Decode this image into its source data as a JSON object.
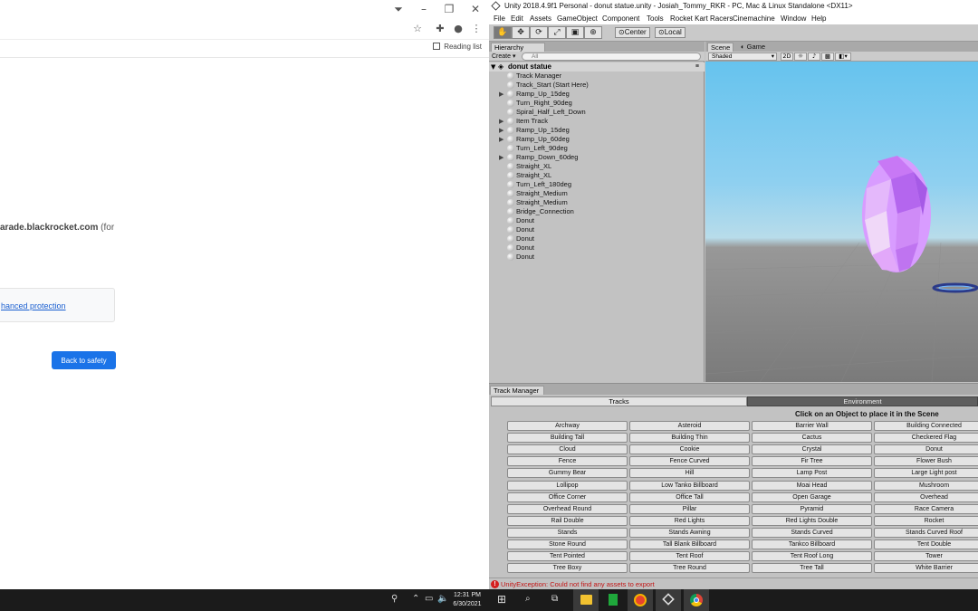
{
  "browser": {
    "reading_list": "Reading list",
    "warning_domain": "arade.blackrocket.com",
    "warning_suffix": " (for",
    "enhanced_link": "hanced protection",
    "back_button": "Back to safety"
  },
  "unity": {
    "title": "Unity 2018.4.9f1 Personal - donut statue.unity - Josiah_Tommy_RKR - PC, Mac & Linux Standalone <DX11>",
    "menu": [
      "File",
      "Edit",
      "Assets",
      "GameObject",
      "Component",
      "Tools",
      "Rocket Kart Racers",
      "Cinemachine",
      "Window",
      "Help"
    ],
    "toolbar": {
      "center": "Center",
      "local": "Local"
    },
    "hierarchy": {
      "tab": "Hierarchy",
      "create": "Create",
      "search_placeholder": "All",
      "scene_name": "donut statue",
      "items": [
        {
          "label": "Track Manager",
          "expand": false
        },
        {
          "label": "Track_Start (Start Here)",
          "expand": false
        },
        {
          "label": "Ramp_Up_15deg",
          "expand": true
        },
        {
          "label": "Turn_Right_90deg",
          "expand": false
        },
        {
          "label": "Spiral_Half_Left_Down",
          "expand": false
        },
        {
          "label": "Item Track",
          "expand": true
        },
        {
          "label": "Ramp_Up_15deg",
          "expand": true
        },
        {
          "label": "Ramp_Up_60deg",
          "expand": true
        },
        {
          "label": "Turn_Left_90deg",
          "expand": false
        },
        {
          "label": "Ramp_Down_60deg",
          "expand": true
        },
        {
          "label": "Straight_XL",
          "expand": false
        },
        {
          "label": "Straight_XL",
          "expand": false
        },
        {
          "label": "Turn_Left_180deg",
          "expand": false
        },
        {
          "label": "Straight_Medium",
          "expand": false
        },
        {
          "label": "Straight_Medium",
          "expand": false
        },
        {
          "label": "Bridge_Connection",
          "expand": false
        },
        {
          "label": "Donut",
          "expand": false
        },
        {
          "label": "Donut",
          "expand": false
        },
        {
          "label": "Donut",
          "expand": false
        },
        {
          "label": "Donut",
          "expand": false
        },
        {
          "label": "Donut",
          "expand": false
        }
      ]
    },
    "scene": {
      "tab_scene": "Scene",
      "tab_game": "Game",
      "shading": "Shaded",
      "mode_2d": "2D"
    },
    "track_manager": {
      "tab": "Track Manager",
      "tracks_tab": "Tracks",
      "environment_tab": "Environment",
      "instruction": "Click on an Object to place it in the Scene",
      "objects": [
        "Archway",
        "Asteroid",
        "Barrier Wall",
        "Building Connected",
        "Building Tall",
        "Building Thin",
        "Cactus",
        "Checkered Flag",
        "Cloud",
        "Cookie",
        "Crystal",
        "Donut",
        "Fence",
        "Fence Curved",
        "Fir Tree",
        "Flower Bush",
        "Gummy Bear",
        "Hill",
        "Lamp Post",
        "Large Light post",
        "Lollipop",
        "Low Tanko Billboard",
        "Moai Head",
        "Mushroom",
        "Office Corner",
        "Office Tall",
        "Open Garage",
        "Overhead",
        "Overhead Round",
        "Pillar",
        "Pyramid",
        "Race Camera",
        "Rail Double",
        "Red Lights",
        "Red Lights Double",
        "Rocket",
        "Stands",
        "Stands Awning",
        "Stands Curved",
        "Stands Curved Roof",
        "Stone Round",
        "Tall Blank Billboard",
        "Tankco Billboard",
        "Tent Double",
        "Tent Pointed",
        "Tent Roof",
        "Tent Roof Long",
        "Tower",
        "Tree Boxy",
        "Tree Round",
        "Tree Tall",
        "White Barrier"
      ]
    },
    "status": {
      "error": "UnityException: Could not find any assets to export"
    }
  },
  "taskbar": {
    "time": "12:31 PM",
    "date": "6/30/2021"
  }
}
